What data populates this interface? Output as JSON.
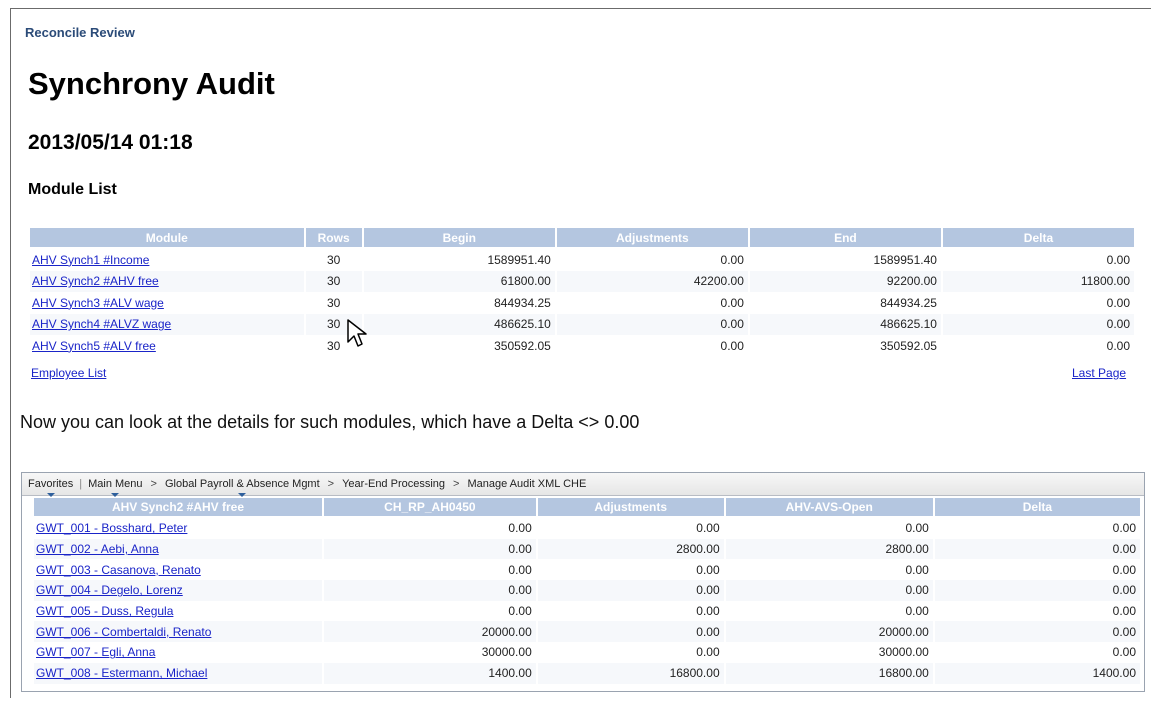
{
  "breadcrumb": "Reconcile Review",
  "title": "Synchrony Audit",
  "datetime": "2013/05/14 01:18",
  "section_title": "Module List",
  "module_table": {
    "headers": [
      "Module",
      "Rows",
      "Begin",
      "Adjustments",
      "End",
      "Delta"
    ],
    "rows": [
      {
        "module": "AHV Synch1 #Income",
        "rows": "30",
        "begin": "1589951.40",
        "adjustments": "0.00",
        "end": "1589951.40",
        "delta": "0.00"
      },
      {
        "module": "AHV Synch2 #AHV free",
        "rows": "30",
        "begin": "61800.00",
        "adjustments": "42200.00",
        "end": "92200.00",
        "delta": "11800.00"
      },
      {
        "module": "AHV Synch3 #ALV wage",
        "rows": "30",
        "begin": "844934.25",
        "adjustments": "0.00",
        "end": "844934.25",
        "delta": "0.00"
      },
      {
        "module": "AHV Synch4 #ALVZ wage",
        "rows": "30",
        "begin": "486625.10",
        "adjustments": "0.00",
        "end": "486625.10",
        "delta": "0.00"
      },
      {
        "module": "AHV Synch5 #ALV free",
        "rows": "30",
        "begin": "350592.05",
        "adjustments": "0.00",
        "end": "350592.05",
        "delta": "0.00"
      }
    ]
  },
  "employee_list_link": "Employee List",
  "last_page_link": "Last Page",
  "note": "Now you can look at the details for such modules, which have a Delta <> 0.00",
  "navbar": {
    "favorites": "Favorites",
    "main_menu": "Main Menu",
    "crumb1": "Global Payroll & Absence Mgmt",
    "crumb2": "Year-End Processing",
    "crumb3": "Manage Audit XML CHE",
    "chevron": ">"
  },
  "detail_table": {
    "headers": [
      "AHV Synch2 #AHV free",
      "CH_RP_AH0450",
      "Adjustments",
      "AHV-AVS-Open",
      "Delta"
    ],
    "rows": [
      {
        "name": "GWT_001 - Bosshard, Peter",
        "c1": "0.00",
        "adj": "0.00",
        "open": "0.00",
        "delta": "0.00"
      },
      {
        "name": "GWT_002 - Aebi, Anna",
        "c1": "0.00",
        "adj": "2800.00",
        "open": "2800.00",
        "delta": "0.00"
      },
      {
        "name": "GWT_003 - Casanova, Renato",
        "c1": "0.00",
        "adj": "0.00",
        "open": "0.00",
        "delta": "0.00"
      },
      {
        "name": "GWT_004 - Degelo, Lorenz",
        "c1": "0.00",
        "adj": "0.00",
        "open": "0.00",
        "delta": "0.00"
      },
      {
        "name": "GWT_005 - Duss, Regula",
        "c1": "0.00",
        "adj": "0.00",
        "open": "0.00",
        "delta": "0.00"
      },
      {
        "name": "GWT_006 - Combertaldi, Renato",
        "c1": "20000.00",
        "adj": "0.00",
        "open": "20000.00",
        "delta": "0.00"
      },
      {
        "name": "GWT_007 - Egli, Anna",
        "c1": "30000.00",
        "adj": "0.00",
        "open": "30000.00",
        "delta": "0.00"
      },
      {
        "name": "GWT_008 - Estermann, Michael",
        "c1": "1400.00",
        "adj": "16800.00",
        "open": "16800.00",
        "delta": "1400.00"
      }
    ]
  }
}
